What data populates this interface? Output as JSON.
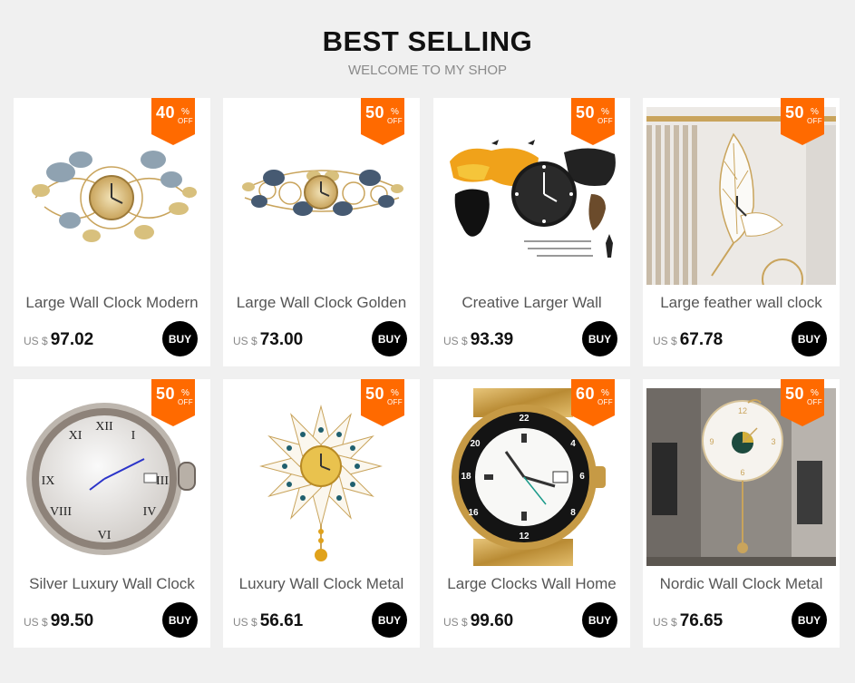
{
  "header": {
    "title": "BEST SELLING",
    "subtitle": "WELCOME TO MY SHOP"
  },
  "badge_color": "#ff6a00",
  "buy_button_color": "#000000",
  "products": [
    {
      "name": "Large Wall Clock Modern",
      "currency": "US $",
      "price": "97.02",
      "discount": "40",
      "percent_sign": "%",
      "off_label": "OFF",
      "buy_label": "BUY",
      "icon": "ginkgo-leaf-clock-icon"
    },
    {
      "name": "Large Wall Clock Golden",
      "currency": "US $",
      "price": "73.00",
      "discount": "50",
      "percent_sign": "%",
      "off_label": "OFF",
      "buy_label": "BUY",
      "icon": "ginkgo-leaf-clock-icon"
    },
    {
      "name": "Creative Larger Wall",
      "currency": "US $",
      "price": "93.39",
      "discount": "50",
      "percent_sign": "%",
      "off_label": "OFF",
      "buy_label": "BUY",
      "icon": "world-map-clock-icon"
    },
    {
      "name": "Large feather wall clock",
      "currency": "US $",
      "price": "67.78",
      "discount": "50",
      "percent_sign": "%",
      "off_label": "OFF",
      "buy_label": "BUY",
      "icon": "feather-clock-icon"
    },
    {
      "name": "Silver Luxury Wall Clock",
      "currency": "US $",
      "price": "99.50",
      "discount": "50",
      "percent_sign": "%",
      "off_label": "OFF",
      "buy_label": "BUY",
      "icon": "silver-roman-clock-icon"
    },
    {
      "name": "Luxury Wall Clock Metal",
      "currency": "US $",
      "price": "56.61",
      "discount": "50",
      "percent_sign": "%",
      "off_label": "OFF",
      "buy_label": "BUY",
      "icon": "peacock-pendulum-clock-icon"
    },
    {
      "name": "Large Clocks Wall Home",
      "currency": "US $",
      "price": "99.60",
      "discount": "60",
      "percent_sign": "%",
      "off_label": "OFF",
      "buy_label": "BUY",
      "icon": "wristwatch-clock-icon"
    },
    {
      "name": "Nordic Wall Clock Metal",
      "currency": "US $",
      "price": "76.65",
      "discount": "50",
      "percent_sign": "%",
      "off_label": "OFF",
      "buy_label": "BUY",
      "icon": "nordic-pendulum-clock-icon"
    }
  ]
}
